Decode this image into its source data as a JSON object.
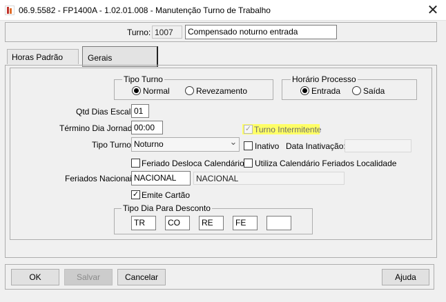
{
  "window": {
    "title": "06.9.5582 - FP1400A - 1.02.01.008 - Manutenção Turno de Trabalho",
    "close_glyph": "✕"
  },
  "header": {
    "turno_label": "Turno:",
    "turno_code": "1007",
    "turno_description": "Compensado noturno entrada"
  },
  "tabs": [
    {
      "label": "Horas Padrão",
      "active": false
    },
    {
      "label": "Gerais",
      "active": true
    }
  ],
  "gerais": {
    "tipo_turno_group": {
      "title": "Tipo Turno",
      "options": [
        {
          "label": "Normal",
          "selected": true
        },
        {
          "label": "Revezamento",
          "selected": false
        }
      ]
    },
    "horario_processo_group": {
      "title": "Horário Processo",
      "options": [
        {
          "label": "Entrada",
          "selected": true
        },
        {
          "label": "Saída",
          "selected": false
        }
      ]
    },
    "qtd_dias_escala": {
      "label": "Qtd Dias Escala:",
      "value": "01"
    },
    "termino_dia_jornada": {
      "label": "Término Dia Jornada:",
      "value": "00:00"
    },
    "turno_intermitente": {
      "label": "Turno Intermitente",
      "checked": true,
      "enabled": false,
      "highlight_color": "#ffff66"
    },
    "tipo_turno_select": {
      "label": "Tipo Turno:",
      "value": "Noturno"
    },
    "inativo": {
      "label": "Inativo",
      "checked": false
    },
    "data_inativacao": {
      "label": "Data Inativação:",
      "value": ""
    },
    "feriado_desloca": {
      "label": "Feriado Desloca Calendário",
      "checked": false
    },
    "utiliza_calendario": {
      "label": "Utiliza Calendário Feriados Localidade",
      "checked": false
    },
    "feriados_nacionais": {
      "label": "Feriados Nacionais:",
      "value": "NACIONAL",
      "description": "NACIONAL"
    },
    "emite_cartao": {
      "label": "Emite Cartão",
      "checked": true
    },
    "tipo_dia_desconto": {
      "title": "Tipo Dia Para Desconto",
      "values": [
        "TR",
        "CO",
        "RE",
        "FE",
        ""
      ]
    }
  },
  "buttons": {
    "ok": "OK",
    "salvar": "Salvar",
    "cancelar": "Cancelar",
    "ajuda": "Ajuda"
  },
  "icons": {
    "check_glyph": "✓",
    "dropdown_glyph": "⌄"
  }
}
